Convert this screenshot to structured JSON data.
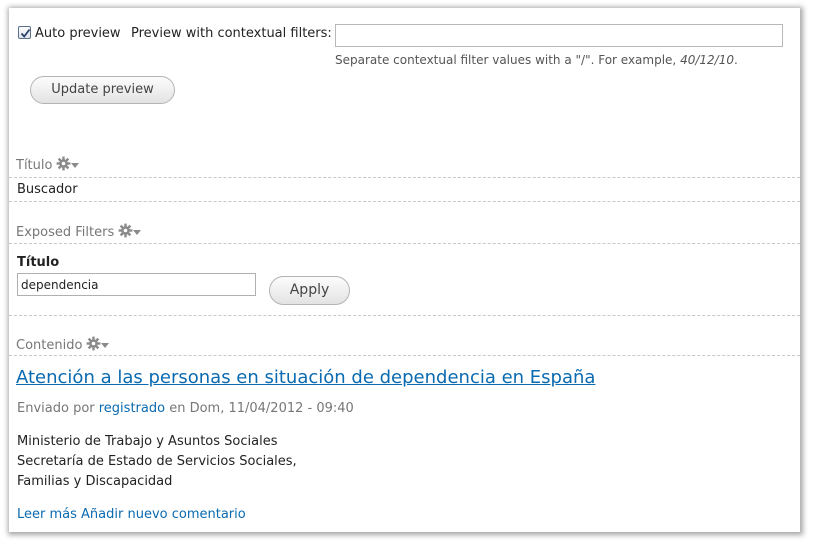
{
  "preview": {
    "auto_preview_label": "Auto preview",
    "auto_preview_checked": true,
    "contextual_label": "Preview with contextual filters:",
    "contextual_value": "",
    "contextual_desc_text": "Separate contextual filter values with a \"/\". For example, ",
    "contextual_desc_example": "40/12/10",
    "contextual_desc_end": ".",
    "update_button": "Update preview"
  },
  "sections": {
    "titulo": {
      "header": "Título",
      "value": "Buscador"
    },
    "exposed": {
      "header": "Exposed Filters",
      "field_label": "Título",
      "field_value": "dependencia",
      "apply_button": "Apply"
    },
    "contenido": {
      "header": "Contenido",
      "node_title": "Atención a las personas en situación de dependencia en España",
      "submitted_prefix": "Enviado por ",
      "submitted_author": "registrado",
      "submitted_suffix": " en Dom, 11/04/2012 - 09:40",
      "body_lines": [
        "Ministerio de Trabajo y Asuntos Sociales",
        "Secretaría de Estado de Servicios Sociales,",
        "Familias y Discapacidad"
      ],
      "link_read_more": "Leer más",
      "link_add_comment": "Añadir nuevo comentario"
    }
  },
  "icons": {
    "gear": "gear-icon",
    "caret": "caret-down-icon",
    "checkbox": "checkmark-icon"
  },
  "colors": {
    "link": "#0a6ab0",
    "section_header": "#777777",
    "dashed_border": "#c8c8c8"
  }
}
